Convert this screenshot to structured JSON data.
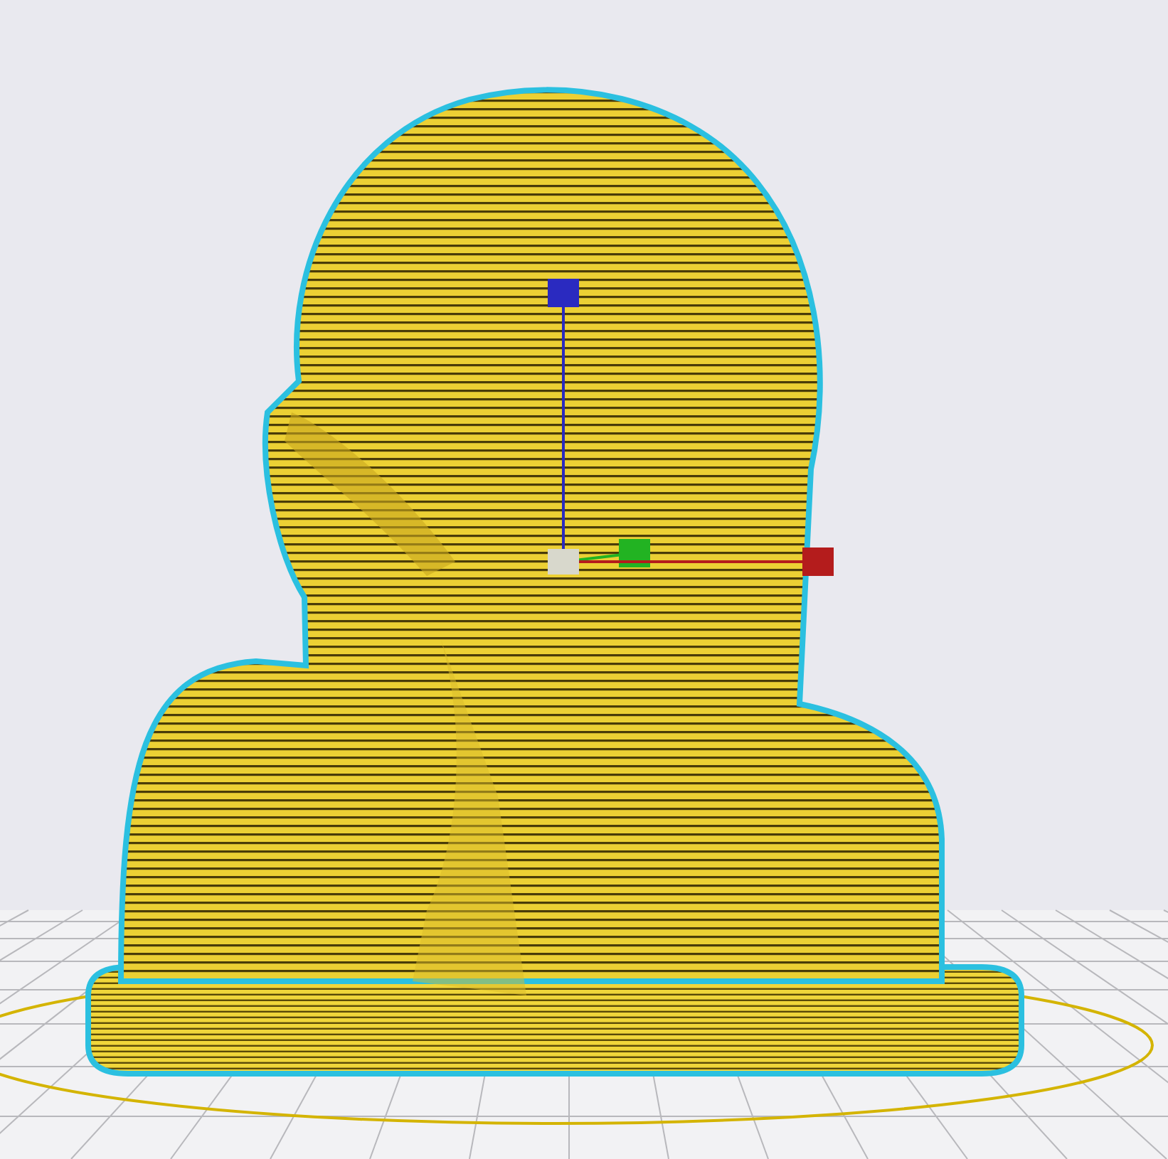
{
  "viewport": {
    "transform_gizmo": {
      "handles": [
        {
          "kind": "vertical",
          "color": "#2a2ac0"
        },
        {
          "kind": "depth",
          "color": "#22b322"
        },
        {
          "kind": "horizontal",
          "color": "#b41c1c"
        }
      ]
    }
  }
}
